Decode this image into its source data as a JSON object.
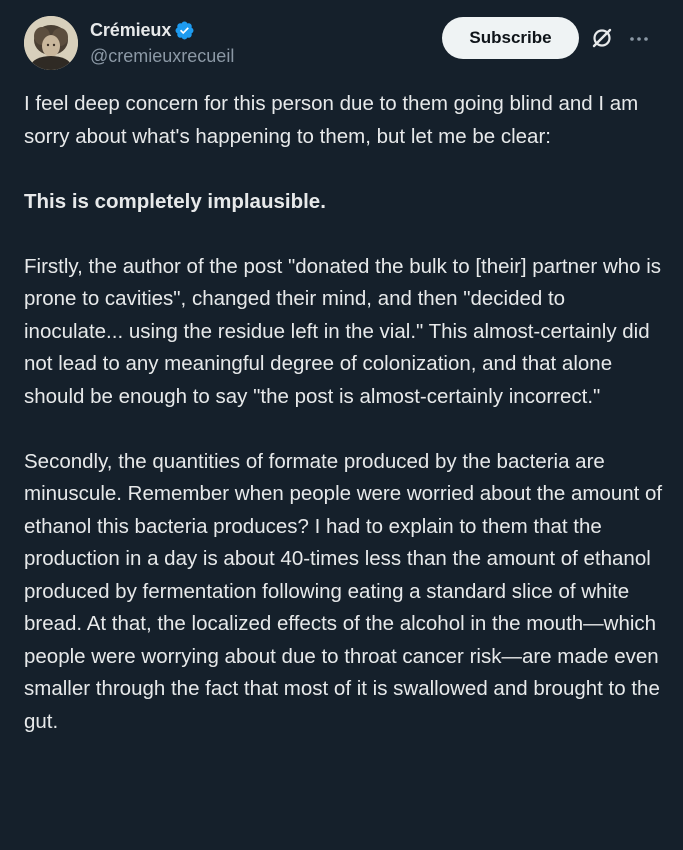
{
  "author": {
    "display_name": "Crémieux",
    "handle": "@cremieuxrecueil",
    "verified": true
  },
  "actions": {
    "subscribe_label": "Subscribe",
    "grok_icon": "grok-icon",
    "more_icon": "more-icon"
  },
  "colors": {
    "background": "#15202b",
    "text": "#e7e9ea",
    "secondary_text": "#8b98a5",
    "verified_blue": "#1d9bf0",
    "subscribe_bg": "#eff3f4"
  },
  "post": {
    "paragraphs": [
      "I feel deep concern for this person due to them going blind and I am sorry about what's happening to them, but let me be clear:",
      "This is completely implausible.",
      "Firstly, the author of the post \"donated the bulk to [their] partner who is prone to cavities\", changed their mind, and then \"decided to inoculate... using the residue left in the vial.\" This almost-certainly did not lead to any meaningful degree of colonization, and that alone should be enough to say \"the post is almost-certainly incorrect.\"",
      "Secondly, the quantities of formate produced by the bacteria are minuscule. Remember when people were worried about the amount of ethanol this bacteria produces? I had to explain to them that the production in a day is about 40-times less than the amount of ethanol produced by fermentation following eating a standard slice of white bread. At that, the localized effects of the alcohol in the mouth—which people were worrying about due to throat cancer risk—are made even smaller through the fact that most of it is swallowed and brought to the gut."
    ]
  }
}
